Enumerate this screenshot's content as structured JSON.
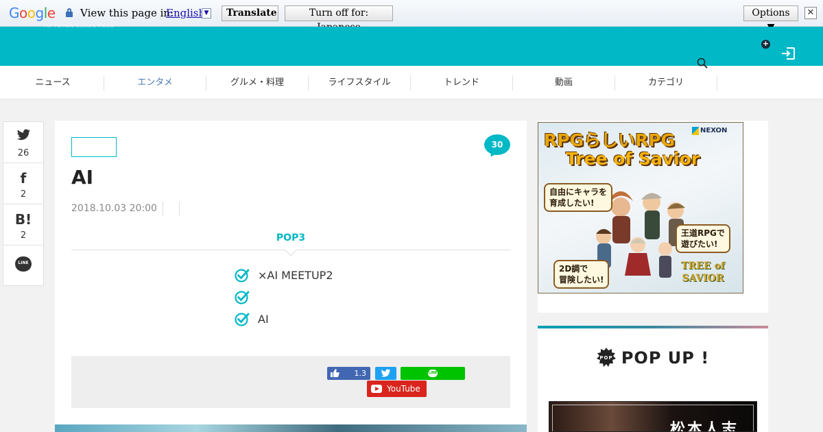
{
  "translate_bar": {
    "logo": [
      "G",
      "o",
      "o",
      "g",
      "l",
      "e"
    ],
    "prompt": "View this page in:",
    "language": "English",
    "language_arrow": "▼",
    "translate_label": "Translate",
    "turn_off_label": "Turn off for: Japanese",
    "options_label": "Options ▼",
    "close_label": "✕"
  },
  "header": {
    "tagline": "For Female Culture Media",
    "plus_glyph": "+"
  },
  "nav": {
    "items": [
      {
        "label": "ニュース"
      },
      {
        "label": "エンタメ"
      },
      {
        "label": "グルメ・料理"
      },
      {
        "label": "ライフスタイル"
      },
      {
        "label": "トレンド"
      },
      {
        "label": "動画"
      },
      {
        "label": "カテゴリ"
      }
    ]
  },
  "share_sidebar": {
    "twitter": {
      "glyph": "🐦",
      "count": "26"
    },
    "facebook": {
      "glyph": "f",
      "count": "2"
    },
    "hatena": {
      "glyph": "B!",
      "count": "2"
    },
    "line": {
      "glyph": "LINE"
    }
  },
  "article": {
    "comment_count": "30",
    "title": "AI",
    "date": "2018.10.03 20:00",
    "pop3_heading": "POP3",
    "pop3_items": [
      "×AI MEETUP2",
      "",
      "AI"
    ],
    "share_box": {
      "fb_count": "1.3",
      "line_label": "LINE",
      "youtube_label": "YouTube"
    }
  },
  "sidebar": {
    "ad": {
      "brand": "NEXON",
      "headline_1": "RPGらしいRPG",
      "headline_2": "Tree of Savior",
      "bubble_1": "自由にキャラを\n育成したい!",
      "bubble_2": "王道RPGで\n遊びたい!",
      "bubble_3": "2D調で\n冒険したい!",
      "logo_text": "TREE of\nSAVIOR"
    },
    "popup": {
      "icon_text": "POP",
      "title": "POP UP !",
      "thumb_text": "松本人志"
    }
  },
  "colors": {
    "brand_teal": "#00b8c6",
    "nav_active": "#4a78b5",
    "youtube_red": "#d9251d",
    "facebook_blue": "#4267b2",
    "twitter_blue": "#1da1f2",
    "line_green": "#00c300"
  }
}
